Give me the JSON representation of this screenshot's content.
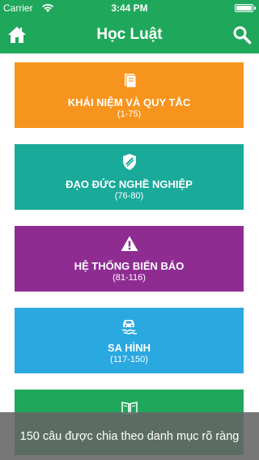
{
  "status_bar": {
    "carrier": "Carrier",
    "time": "3:44 PM",
    "wifi_icon": "wifi-icon",
    "battery_icon": "battery-icon"
  },
  "nav": {
    "title": "Học Luật",
    "home_icon": "home-icon",
    "search_icon": "search-icon",
    "color": "#1fa85b"
  },
  "categories": [
    {
      "label": "KHÁI NIỆM VÀ QUY TẮC",
      "range": "(1-75)",
      "color": "#f7941d",
      "icon": "book-icon"
    },
    {
      "label": "ĐẠO ĐỨC NGHỀ NGHIỆP",
      "range": "(76-80)",
      "color": "#1aaa9a",
      "icon": "shield-icon"
    },
    {
      "label": "HỆ THỐNG BIỂN BÁO",
      "range": "(81-116)",
      "color": "#8e2c91",
      "icon": "warning-icon"
    },
    {
      "label": "SA HÌNH",
      "range": "(117-150)",
      "color": "#2aa8e0",
      "icon": "car-skid-icon"
    },
    {
      "label": "",
      "range": "",
      "color": "#1fa85b",
      "icon": "open-book-icon"
    }
  ],
  "toast": {
    "message": "150 câu được chia theo danh mục rõ ràng"
  }
}
